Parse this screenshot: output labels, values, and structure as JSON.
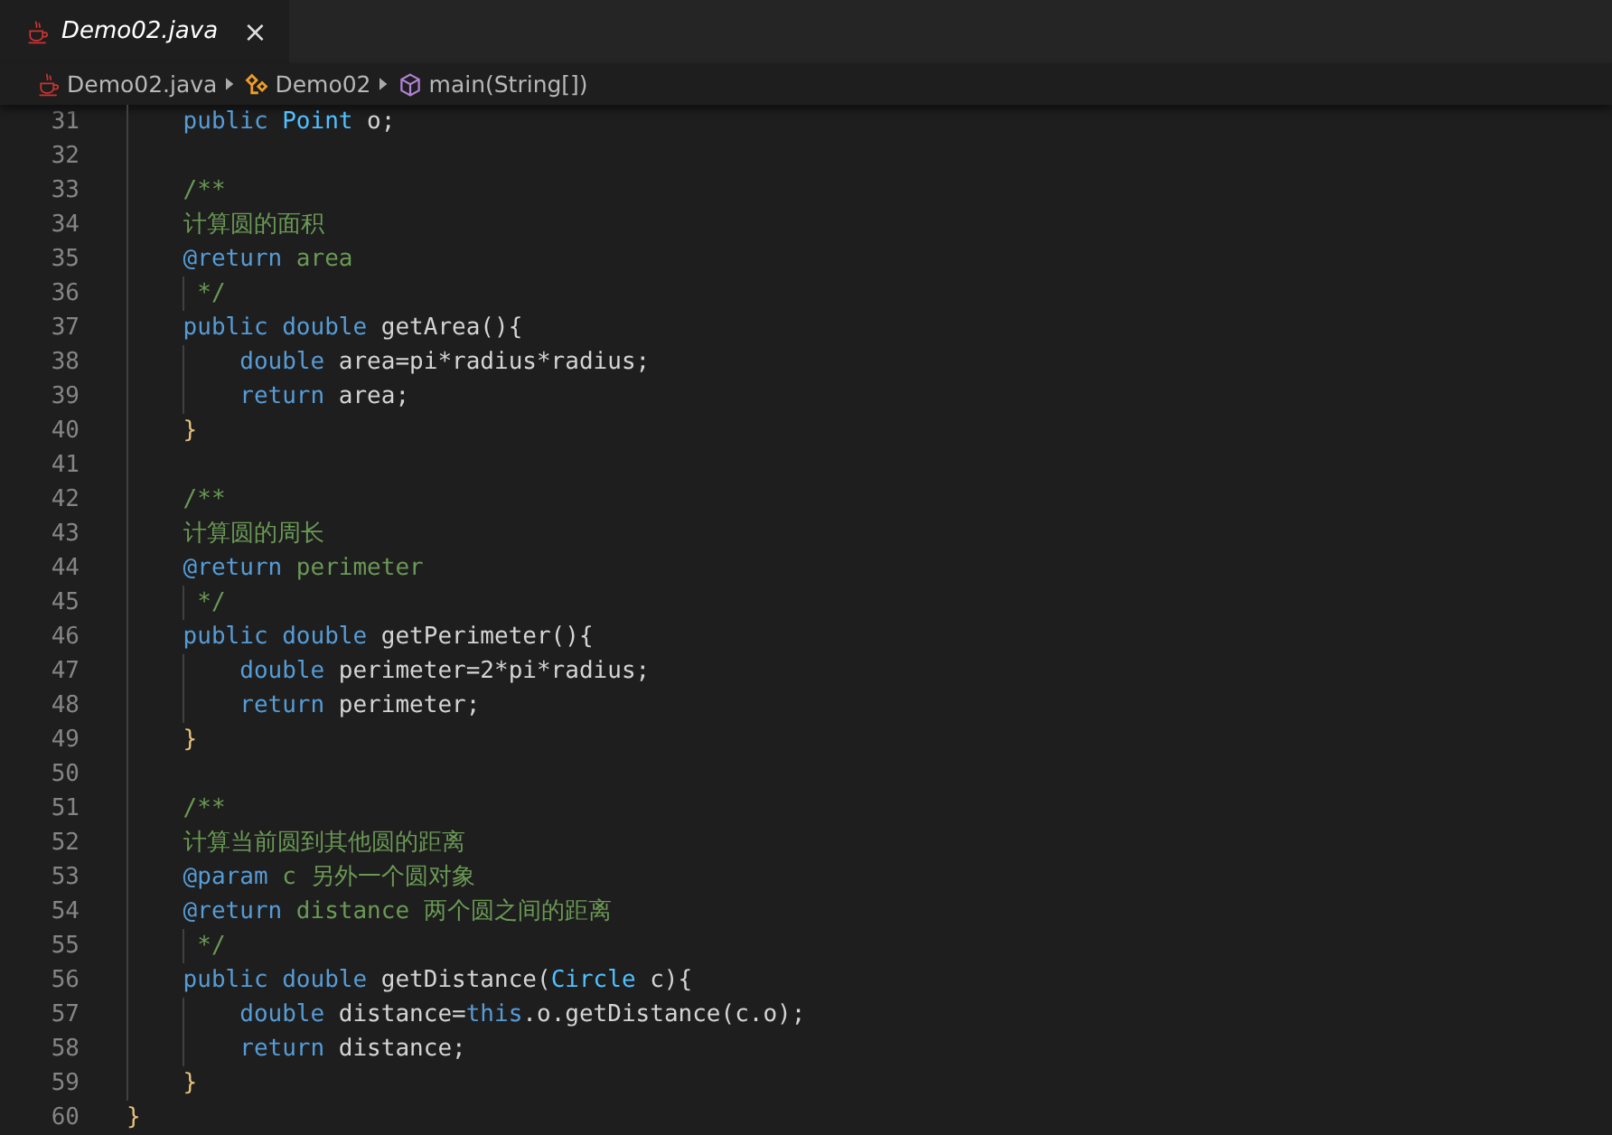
{
  "tabs": [
    {
      "label": "Demo02.java",
      "selected": true,
      "preview": true,
      "close": "×"
    }
  ],
  "breadcrumb": [
    {
      "kind": "file",
      "label": "Demo02.java"
    },
    {
      "kind": "class",
      "label": "Demo02"
    },
    {
      "kind": "method",
      "label": "main(String[])"
    }
  ],
  "lines": [
    {
      "number": "31",
      "tokens": [
        {
          "kind": "kw",
          "text": "    public "
        },
        {
          "kind": "type",
          "text": "Point"
        },
        {
          "kind": "plain",
          "text": " o;"
        }
      ]
    },
    {
      "number": "32"
    },
    {
      "number": "33",
      "tokens": [
        {
          "kind": "comment",
          "text": "    /**"
        }
      ]
    },
    {
      "number": "34",
      "tokens": [
        {
          "kind": "comment",
          "text": "    计算圆的面积"
        }
      ]
    },
    {
      "number": "35",
      "tokens": [
        {
          "kind": "tag",
          "text": "    @return"
        },
        {
          "kind": "comment",
          "text": " area"
        }
      ]
    },
    {
      "number": "36",
      "tokens": [
        {
          "kind": "comment",
          "text": "     */"
        }
      ]
    },
    {
      "number": "37",
      "tokens": [
        {
          "kind": "kw",
          "text": "    public double "
        },
        {
          "kind": "plain",
          "text": "getArea(){"
        }
      ]
    },
    {
      "number": "38",
      "tokens": [
        {
          "kind": "kw",
          "text": "        double "
        },
        {
          "kind": "plain",
          "text": "area=pi*radius*radius;"
        }
      ]
    },
    {
      "number": "39",
      "tokens": [
        {
          "kind": "kw",
          "text": "        return "
        },
        {
          "kind": "plain",
          "text": "area;"
        }
      ]
    },
    {
      "number": "40",
      "tokens": [
        {
          "kind": "bracket",
          "text": "    }"
        }
      ]
    },
    {
      "number": "41"
    },
    {
      "number": "42",
      "tokens": [
        {
          "kind": "comment",
          "text": "    /**"
        }
      ]
    },
    {
      "number": "43",
      "tokens": [
        {
          "kind": "comment",
          "text": "    计算圆的周长"
        }
      ]
    },
    {
      "number": "44",
      "tokens": [
        {
          "kind": "tag",
          "text": "    @return"
        },
        {
          "kind": "comment",
          "text": " perimeter"
        }
      ]
    },
    {
      "number": "45",
      "tokens": [
        {
          "kind": "comment",
          "text": "     */"
        }
      ]
    },
    {
      "number": "46",
      "tokens": [
        {
          "kind": "kw",
          "text": "    public double "
        },
        {
          "kind": "plain",
          "text": "getPerimeter(){"
        }
      ]
    },
    {
      "number": "47",
      "tokens": [
        {
          "kind": "kw",
          "text": "        double "
        },
        {
          "kind": "plain",
          "text": "perimeter=2*pi*radius;"
        }
      ]
    },
    {
      "number": "48",
      "tokens": [
        {
          "kind": "kw",
          "text": "        return "
        },
        {
          "kind": "plain",
          "text": "perimeter;"
        }
      ]
    },
    {
      "number": "49",
      "tokens": [
        {
          "kind": "bracket",
          "text": "    }"
        }
      ]
    },
    {
      "number": "50"
    },
    {
      "number": "51",
      "tokens": [
        {
          "kind": "comment",
          "text": "    /**"
        }
      ]
    },
    {
      "number": "52",
      "tokens": [
        {
          "kind": "comment",
          "text": "    计算当前圆到其他圆的距离"
        }
      ]
    },
    {
      "number": "53",
      "tokens": [
        {
          "kind": "tag",
          "text": "    @param"
        },
        {
          "kind": "comment",
          "text": " c 另外一个圆对象"
        }
      ]
    },
    {
      "number": "54",
      "tokens": [
        {
          "kind": "tag",
          "text": "    @return"
        },
        {
          "kind": "comment",
          "text": " distance 两个圆之间的距离"
        }
      ]
    },
    {
      "number": "55",
      "tokens": [
        {
          "kind": "comment",
          "text": "     */"
        }
      ]
    },
    {
      "number": "56",
      "tokens": [
        {
          "kind": "kw",
          "text": "    public double "
        },
        {
          "kind": "plain",
          "text": "getDistance("
        },
        {
          "kind": "type",
          "text": "Circle"
        },
        {
          "kind": "plain",
          "text": " c){"
        }
      ]
    },
    {
      "number": "57",
      "tokens": [
        {
          "kind": "kw",
          "text": "        double "
        },
        {
          "kind": "plain",
          "text": "distance="
        },
        {
          "kind": "kw",
          "text": "this"
        },
        {
          "kind": "plain",
          "text": ".o.getDistance(c.o);"
        }
      ]
    },
    {
      "number": "58",
      "tokens": [
        {
          "kind": "kw",
          "text": "        return "
        },
        {
          "kind": "plain",
          "text": "distance;"
        }
      ]
    },
    {
      "number": "59",
      "tokens": [
        {
          "kind": "bracket",
          "text": "    }"
        }
      ]
    },
    {
      "number": "60",
      "tokens": [
        {
          "kind": "bracket",
          "text": "}"
        }
      ]
    }
  ]
}
